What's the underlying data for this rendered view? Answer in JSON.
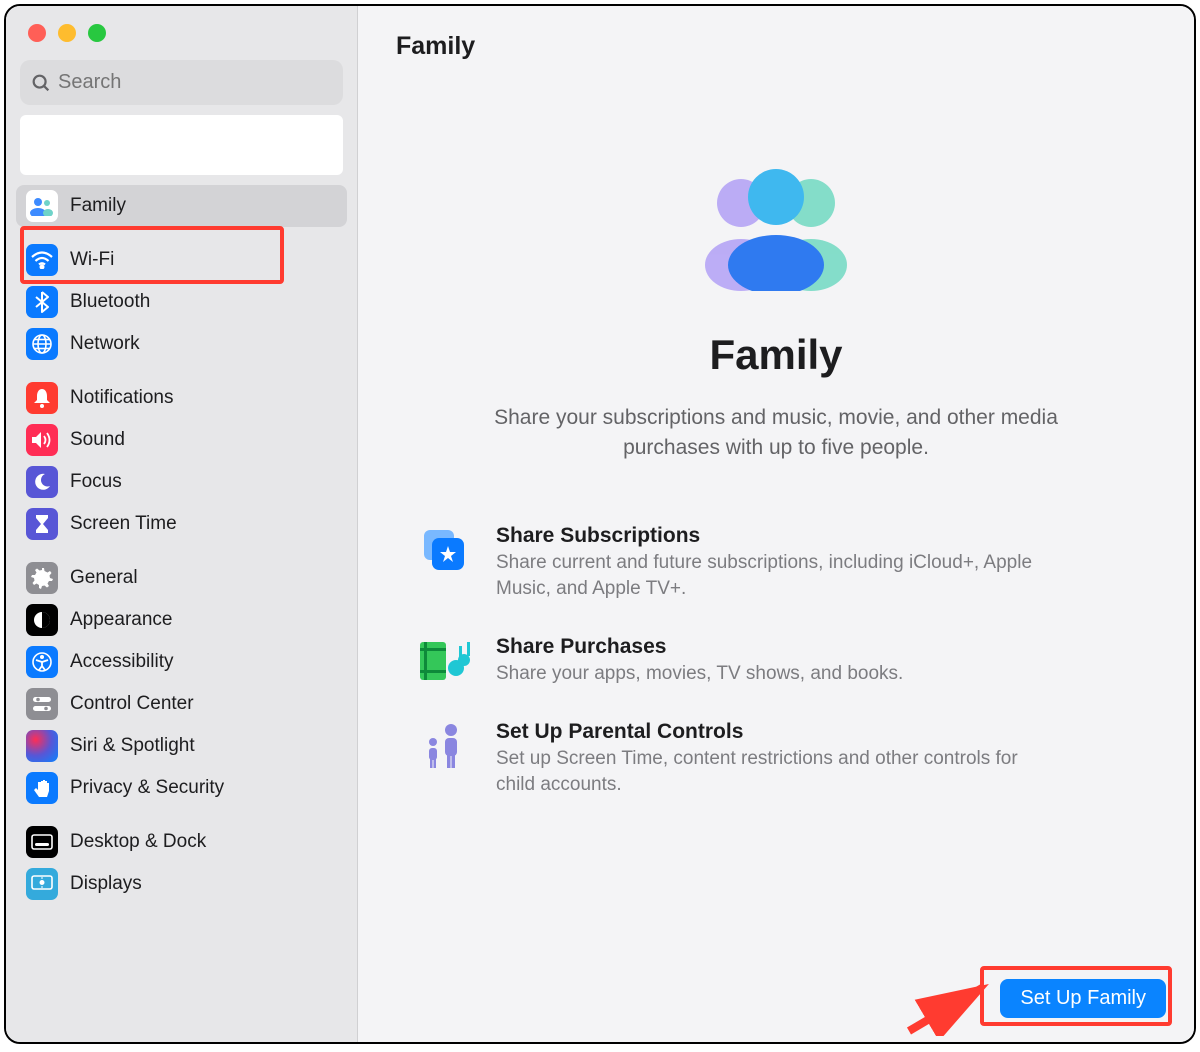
{
  "search": {
    "placeholder": "Search"
  },
  "sidebar": {
    "items": [
      {
        "label": "Family",
        "icon": "family",
        "selected": true,
        "bg": "#ffffff"
      },
      {
        "label": "Wi-Fi",
        "icon": "wifi",
        "bg": "#0a7aff"
      },
      {
        "label": "Bluetooth",
        "icon": "bluetooth",
        "bg": "#0a7aff"
      },
      {
        "label": "Network",
        "icon": "network",
        "bg": "#0a7aff"
      },
      {
        "label": "Notifications",
        "icon": "bell",
        "bg": "#ff3b30"
      },
      {
        "label": "Sound",
        "icon": "sound",
        "bg": "#ff2d55"
      },
      {
        "label": "Focus",
        "icon": "moon",
        "bg": "#5856d6"
      },
      {
        "label": "Screen Time",
        "icon": "hourglass",
        "bg": "#5856d6"
      },
      {
        "label": "General",
        "icon": "gear",
        "bg": "#8e8e93"
      },
      {
        "label": "Appearance",
        "icon": "appearance",
        "bg": "#000000"
      },
      {
        "label": "Accessibility",
        "icon": "accessibility",
        "bg": "#0a7aff"
      },
      {
        "label": "Control Center",
        "icon": "controlcenter",
        "bg": "#8e8e93"
      },
      {
        "label": "Siri & Spotlight",
        "icon": "siri",
        "bg": "#1d1d1f"
      },
      {
        "label": "Privacy & Security",
        "icon": "hand",
        "bg": "#0a7aff"
      },
      {
        "label": "Desktop & Dock",
        "icon": "dock",
        "bg": "#000000"
      },
      {
        "label": "Displays",
        "icon": "displays",
        "bg": "#34aadc"
      }
    ]
  },
  "main": {
    "title": "Family",
    "hero_heading": "Family",
    "hero_sub": "Share your subscriptions and music, movie, and other media purchases with up to five people.",
    "features": [
      {
        "title": "Share Subscriptions",
        "desc": "Share current and future subscriptions, including iCloud+, Apple Music, and Apple TV+.",
        "icon": "share-sub"
      },
      {
        "title": "Share Purchases",
        "desc": "Share your apps, movies, TV shows, and books.",
        "icon": "share-purch"
      },
      {
        "title": "Set Up Parental Controls",
        "desc": "Set up Screen Time, content restrictions and other controls for child accounts.",
        "icon": "parental"
      }
    ],
    "cta_label": "Set Up Family"
  }
}
